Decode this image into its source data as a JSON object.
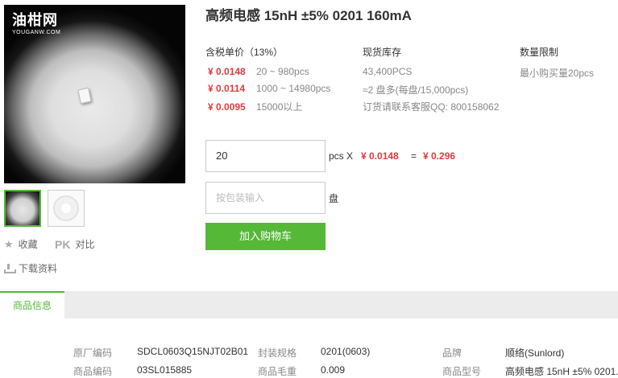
{
  "logo": {
    "name": "油柑网",
    "domain": "YOUGANW.COM"
  },
  "product": {
    "title": "高频电感 15nH ±5% 0201 160mA"
  },
  "side_actions": {
    "favorite": "收藏",
    "pk_mark": "PK",
    "compare": "对比",
    "download": "下载资料"
  },
  "pricing": {
    "header": "含税单价（13%）",
    "tiers": [
      {
        "price": "¥ 0.0148",
        "qty": "20 ~ 980pcs"
      },
      {
        "price": "¥ 0.0114",
        "qty": "1000 ~ 14980pcs"
      },
      {
        "price": "¥ 0.0095",
        "qty": "15000以上"
      }
    ]
  },
  "stock": {
    "header": "现货库存",
    "quantity": "43,400PCS",
    "reels": "≈2 盘多(每盘/15,000pcs)",
    "contact": "订货请联系客服QQ: 800158062"
  },
  "limit": {
    "header": "数量限制",
    "text": "最小购买量20pcs"
  },
  "order": {
    "qty_value": "20",
    "pcs_label": "pcs X",
    "unit_price": "¥ 0.0148",
    "equals": "=",
    "total": "¥ 0.296",
    "pack_placeholder": "按包装输入",
    "pack_unit": "盘",
    "add_to_cart": "加入购物车"
  },
  "tabs": [
    {
      "label": "商品信息"
    }
  ],
  "specs": {
    "row1": [
      {
        "label": "原厂编码",
        "value": "SDCL0603Q15NJT02B01"
      },
      {
        "label": "封装规格",
        "value": "0201(0603)"
      },
      {
        "label": "品牌",
        "value": "顺络(Sunlord)"
      }
    ],
    "row2": [
      {
        "label": "商品编码",
        "value": "03SL015885"
      },
      {
        "label": "商品毛重",
        "value": "0.009"
      },
      {
        "label": "商品型号",
        "value": "高频电感 15nH ±5% 0201..."
      }
    ]
  },
  "colors": {
    "accent_green": "#55b837",
    "price_red": "#e4393c",
    "muted_text": "#888888"
  }
}
